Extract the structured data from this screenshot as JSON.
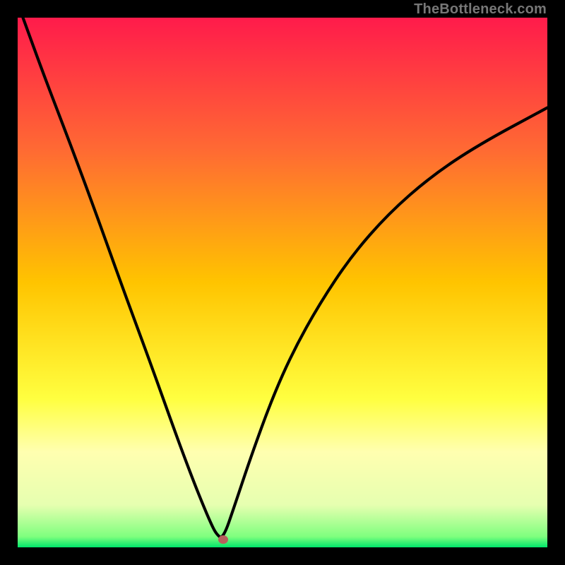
{
  "watermark": "TheBottleneck.com",
  "chart_data": {
    "type": "line",
    "title": "",
    "xlabel": "",
    "ylabel": "",
    "xlim": [
      0,
      100
    ],
    "ylim": [
      0,
      100
    ],
    "gradient_stops": [
      {
        "offset": 0.0,
        "color": "#ff1b4b"
      },
      {
        "offset": 0.25,
        "color": "#ff6a33"
      },
      {
        "offset": 0.5,
        "color": "#ffc400"
      },
      {
        "offset": 0.72,
        "color": "#ffff40"
      },
      {
        "offset": 0.82,
        "color": "#ffffb0"
      },
      {
        "offset": 0.92,
        "color": "#e6ffb0"
      },
      {
        "offset": 0.98,
        "color": "#7eff7e"
      },
      {
        "offset": 1.0,
        "color": "#00e66b"
      }
    ],
    "series": [
      {
        "name": "bottleneck-curve",
        "x": [
          1,
          5,
          10,
          15,
          20,
          25,
          30,
          33,
          35,
          36.5,
          37.5,
          38.75,
          41,
          44,
          48,
          52,
          57,
          63,
          70,
          78,
          87,
          100
        ],
        "y": [
          100,
          89,
          76,
          62.5,
          48.5,
          35,
          21,
          13,
          8,
          4.5,
          2.5,
          1.5,
          8,
          17,
          28,
          37,
          46,
          55,
          63,
          70,
          76,
          83
        ]
      }
    ],
    "marker": {
      "x": 38.75,
      "y": 1.5,
      "color": "#b7605c"
    }
  }
}
